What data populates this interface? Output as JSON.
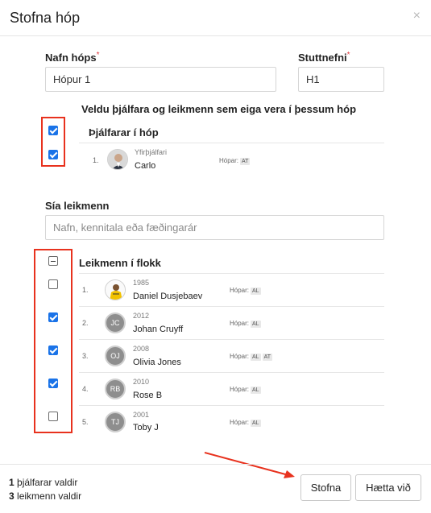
{
  "dialog": {
    "title": "Stofna hóp",
    "close_glyph": "×"
  },
  "form": {
    "name_label": "Nafn hóps",
    "name_value": "Hópur 1",
    "short_label": "Stuttnefni",
    "short_value": "H1",
    "required_mark": "*",
    "instruction": "Veldu þjálfara og leikmenn sem eiga vera í þessum hóp"
  },
  "coaches": {
    "title": "Þjálfarar í hóp",
    "items": [
      {
        "num": "1.",
        "role": "Yfirþjálfari",
        "name": "Carlo",
        "groups_label": "Hópar:",
        "tags": [
          "AT"
        ],
        "checked": true
      }
    ]
  },
  "filter": {
    "label": "Sía leikmenn",
    "placeholder": "Nafn, kennitala eða fæðingarár"
  },
  "players": {
    "title": "Leikmenn í flokk",
    "items": [
      {
        "num": "1.",
        "year": "1985",
        "name": "Daniel Dusjebaev",
        "initials": "",
        "groups_label": "Hópar:",
        "tags": [
          "AL"
        ],
        "checked": false
      },
      {
        "num": "2.",
        "year": "2012",
        "name": "Johan Cruyff",
        "initials": "JC",
        "groups_label": "Hópar:",
        "tags": [
          "AL"
        ],
        "checked": true
      },
      {
        "num": "3.",
        "year": "2008",
        "name": "Olivia Jones",
        "initials": "OJ",
        "groups_label": "Hópar:",
        "tags": [
          "AL",
          "AT"
        ],
        "checked": true
      },
      {
        "num": "4.",
        "year": "2010",
        "name": "Rose B",
        "initials": "RB",
        "groups_label": "Hópar:",
        "tags": [
          "AL"
        ],
        "checked": true
      },
      {
        "num": "5.",
        "year": "2001",
        "name": "Toby J",
        "initials": "TJ",
        "groups_label": "Hópar:",
        "tags": [
          "AL"
        ],
        "checked": false
      }
    ]
  },
  "footer": {
    "coaches_count": "1",
    "coaches_text": "þjálfarar valdir",
    "players_count": "3",
    "players_text": "leikmenn valdir",
    "create_label": "Stofna",
    "cancel_label": "Hætta við"
  },
  "colors": {
    "accent": "#1a73e8",
    "highlight": "#e8321e"
  }
}
